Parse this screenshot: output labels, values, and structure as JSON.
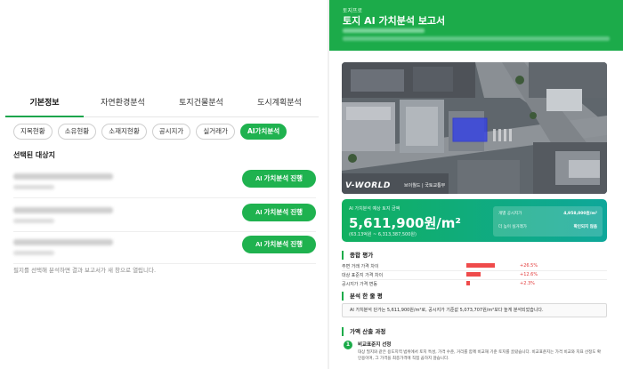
{
  "left": {
    "main_tabs": [
      {
        "label": "기본정보"
      },
      {
        "label": "자연환경분석"
      },
      {
        "label": "토지건물분석"
      },
      {
        "label": "도시계획분석"
      }
    ],
    "sub_tabs": [
      {
        "label": "지목현황"
      },
      {
        "label": "소유현황"
      },
      {
        "label": "소재지현황"
      },
      {
        "label": "공시지가"
      },
      {
        "label": "실거래가"
      },
      {
        "label": "AI가치분석"
      }
    ],
    "section_title": "선택된 대상지",
    "run_button_label": "AI 가치분석 진행",
    "hint": "필지를 선택해 분석하면 결과 보고서가 새 창으로 열립니다."
  },
  "report": {
    "brand": "토지프로",
    "title": "토지 AI 가치분석 보고서",
    "map_logo": "V-WORLD",
    "map_sub": "브이월드 | 국토교통부",
    "price_label": "AI 가치분석 예상 토지 금액",
    "price": "5,611,900원/m²",
    "price_range": "(63.13억원 ~ 6,313,387,500원)",
    "info": {
      "k1": "개별 공시지가",
      "v1": "4,958,000원/m²",
      "k2": "더 높이 실거래가",
      "v2": "확인되지 않음"
    },
    "eval_title": "종합 평가",
    "eval_rows": [
      {
        "label": "주변 거래 가격 차이",
        "value": "+26.5%"
      },
      {
        "label": "대상 표준지 가격 차이",
        "value": "+12.6%"
      },
      {
        "label": "공시지가 가격 변동",
        "value": "+2.3%"
      }
    ],
    "summary_title": "분석 한 줄 평",
    "summary_text": "AI 가치분석 단가는 5,611,900원/m²로, 공시지가 기준값 5,073,707원/m²보다 높게 분석되었습니다.",
    "process_title": "가액 산출 과정",
    "step1_num": "1",
    "step1_title": "비교표준지 선정",
    "step1_text": "대상 필지와 같은 용도지역 범위에서 토지 특성, 가격 수준, 거리를 함께 비교해 기준 토지를 골랐습니다. 비교표준지는 가격 비교와 지표 산정도 확인용이며, 그 가격을 최종가격에 직접 곱하지 않습니다."
  }
}
